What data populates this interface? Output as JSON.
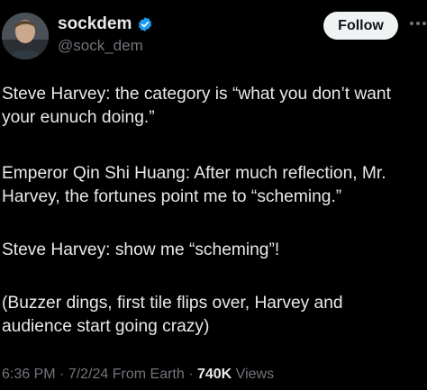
{
  "author": {
    "display_name": "sockdem",
    "handle": "@sock_dem",
    "verified_icon": "verified-badge-icon",
    "avatar_icon": "profile-avatar"
  },
  "follow_button": {
    "label": "Follow"
  },
  "more_icon": "more-options-icon",
  "tweet": {
    "paragraphs": [
      "Steve Harvey: the category is “what you don’t want\nyour eunuch doing.”",
      "Emperor Qin Shi Huang: After much reflection, Mr.\nHarvey, the fortunes point me to “scheming.”",
      "Steve Harvey: show me “scheming”!",
      "(Buzzer dings, first tile flips over, Harvey and\naudience start going crazy)"
    ]
  },
  "meta": {
    "time": "6:36 PM",
    "sep1": " · ",
    "date": "7/2/24",
    "source": " From Earth",
    "sep2": " · ",
    "views_count": "740K",
    "views_label": " Views"
  },
  "colors": {
    "background": "#000000",
    "text": "#e7e9ea",
    "muted": "#71767b",
    "verified": "#1d9bf0",
    "button_bg": "#eff3f4"
  }
}
